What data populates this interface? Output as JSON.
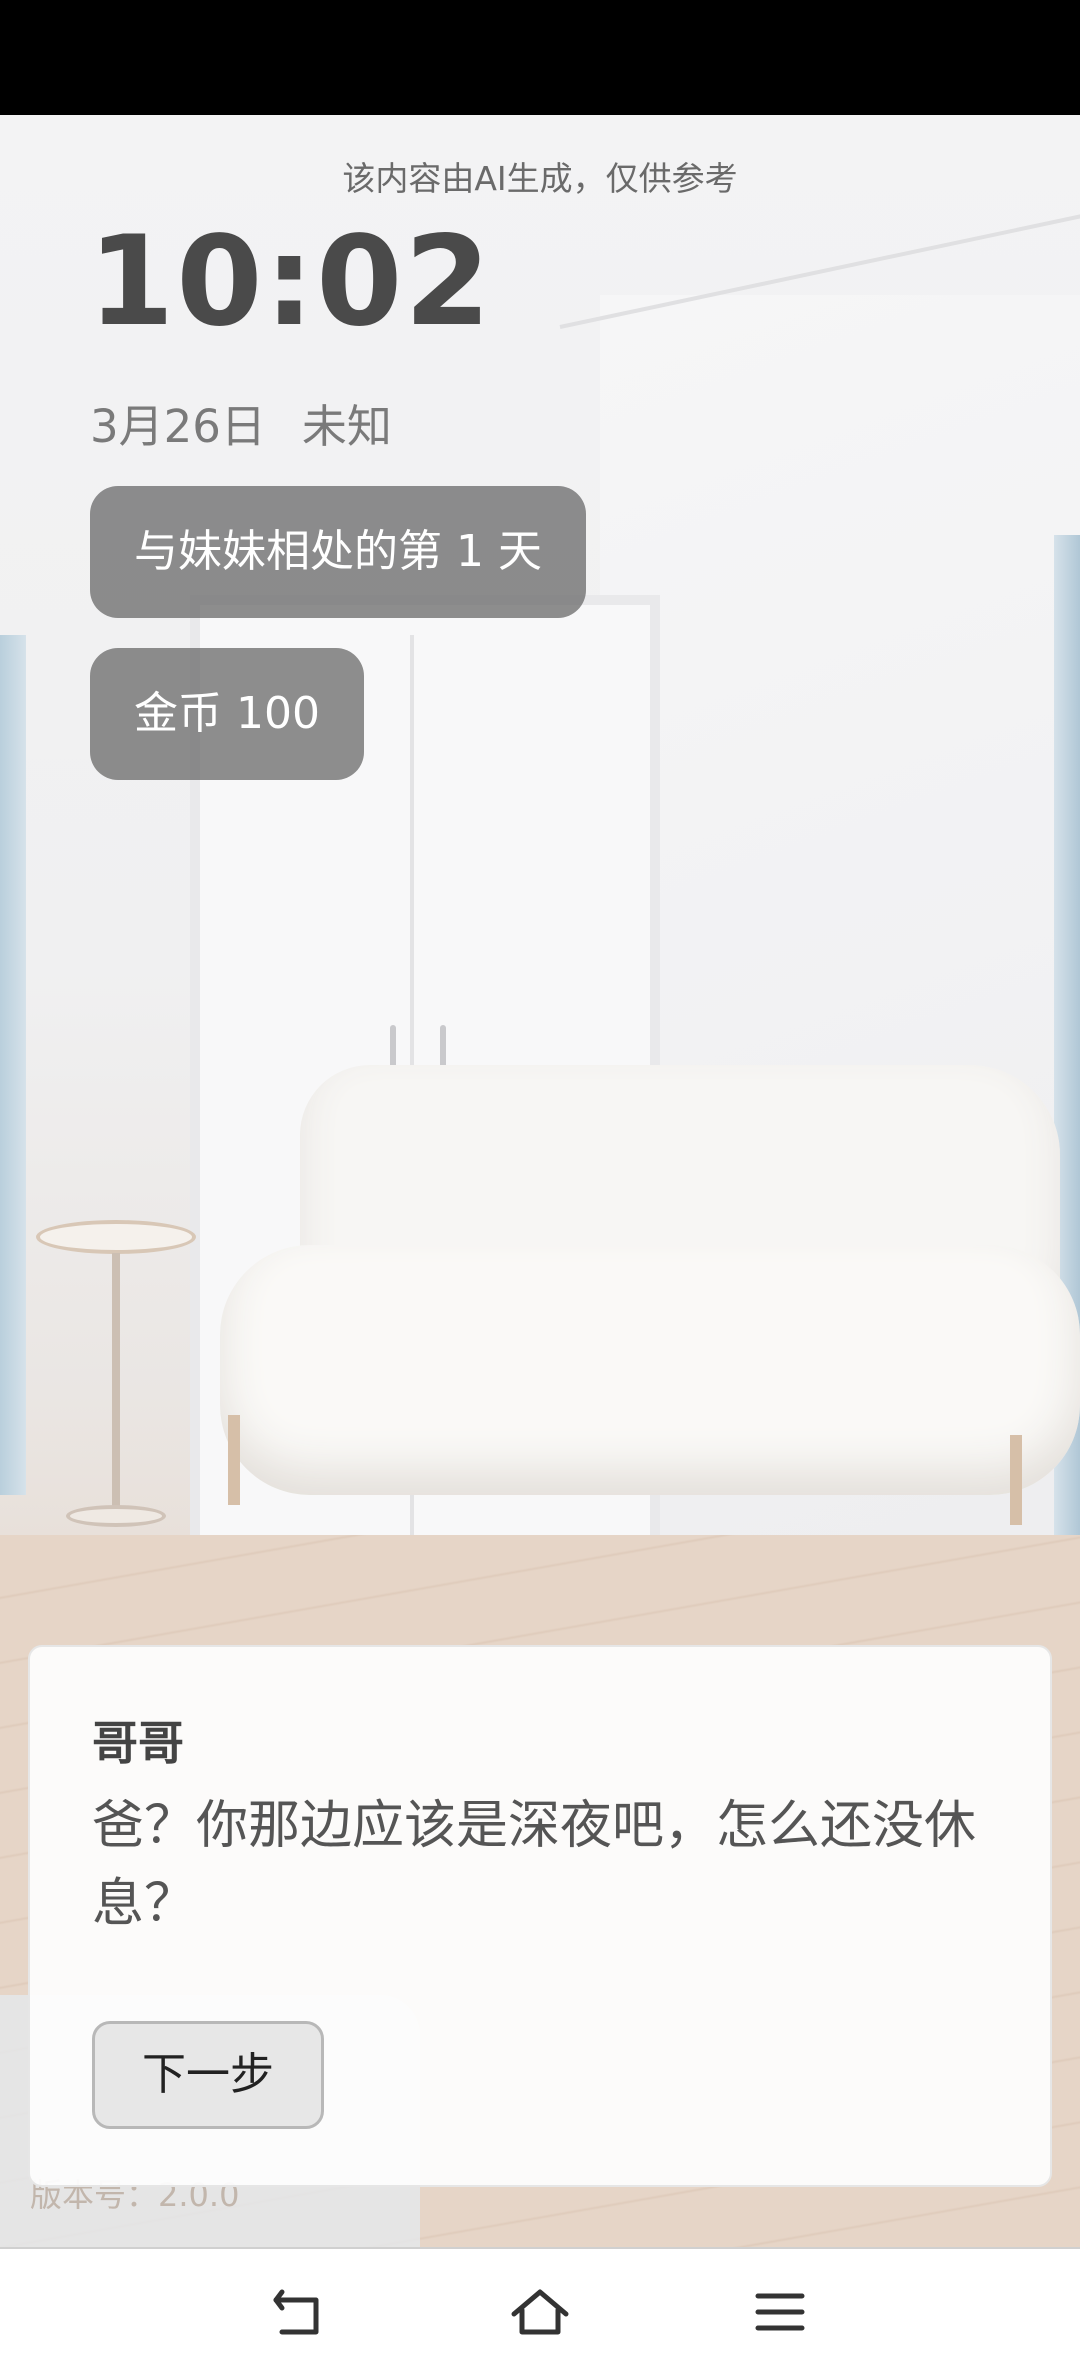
{
  "notice": "该内容由AI生成，仅供参考",
  "clock": {
    "time": "10:02"
  },
  "date": {
    "day": "3月26日",
    "weather": "未知"
  },
  "stats": {
    "days_together": "与妹妹相处的第 1 天",
    "coins": "金币 100"
  },
  "dialog": {
    "speaker": "哥哥",
    "text": "爸？你那边应该是深夜吧，怎么还没休息？",
    "next_label": "下一步"
  },
  "version": "版本号：2.0.0",
  "navbar": {
    "icons": [
      "back-icon",
      "home-icon",
      "menu-icon"
    ]
  }
}
